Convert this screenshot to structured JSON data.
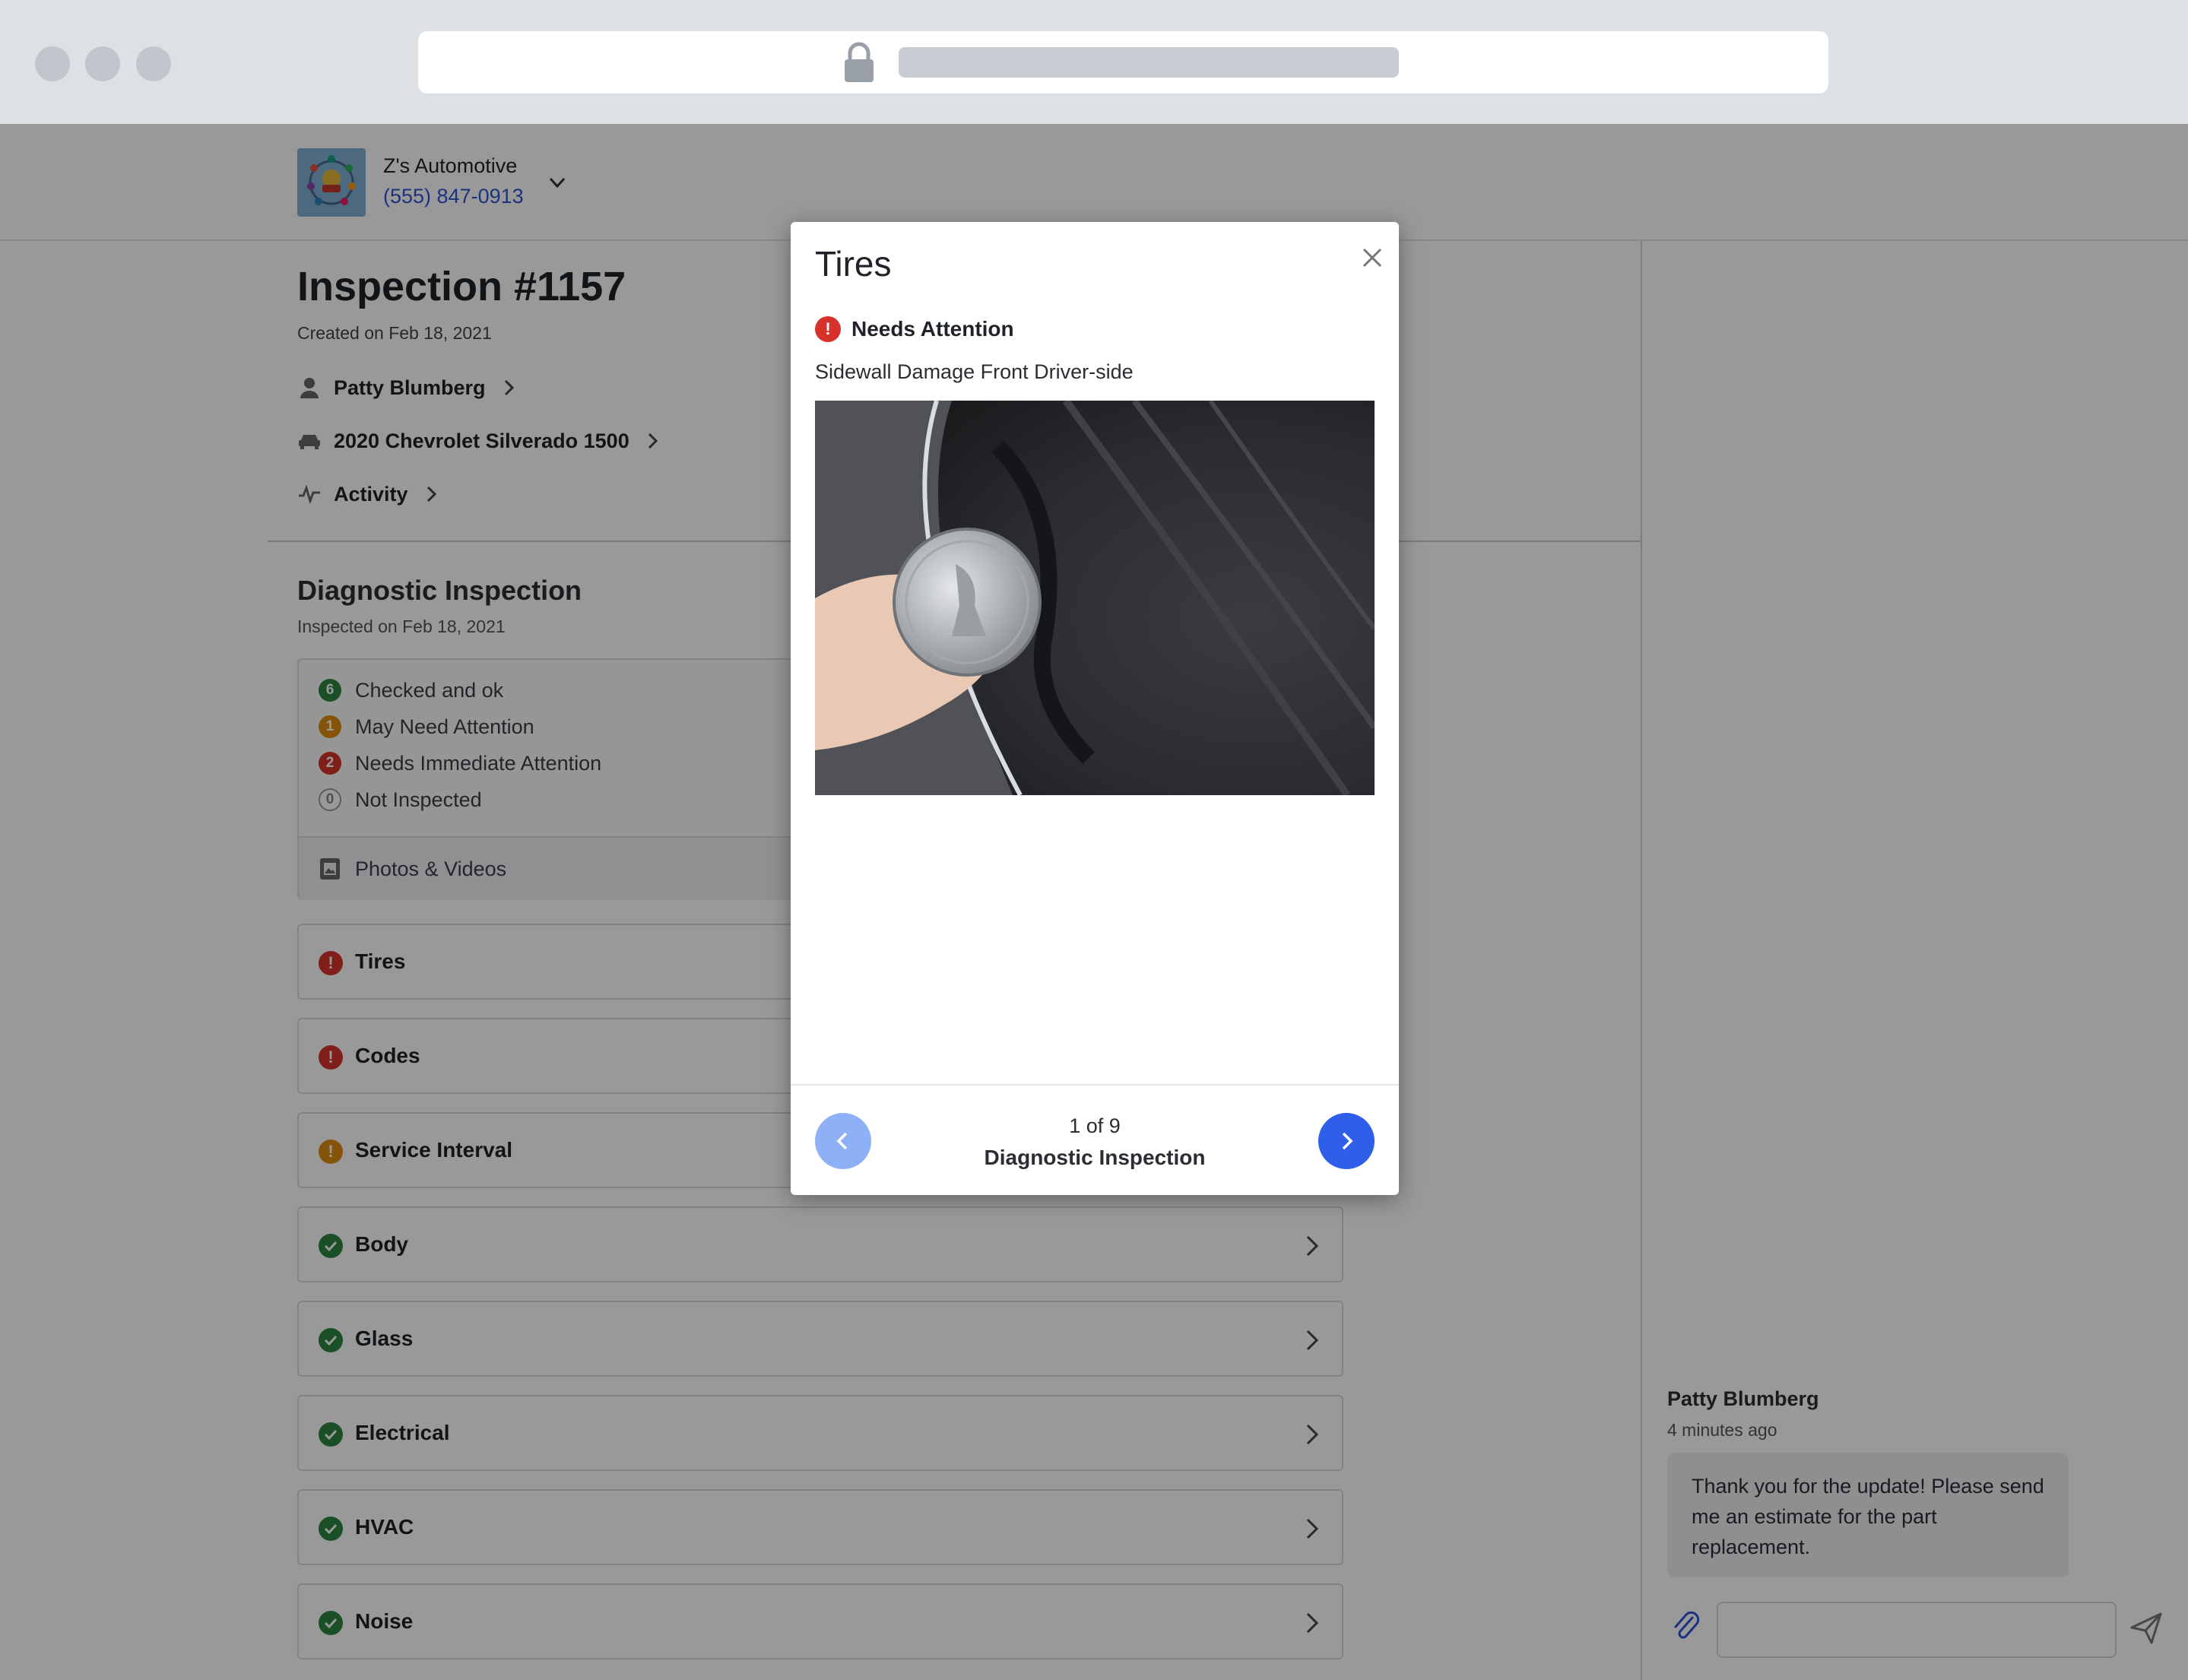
{
  "shop": {
    "name": "Z's Automotive",
    "phone": "(555) 847-0913"
  },
  "inspection": {
    "title": "Inspection #1157",
    "created": "Created on Feb 18, 2021",
    "customer": "Patty Blumberg",
    "vehicle": "2020 Chevrolet Silverado 1500",
    "activity": "Activity"
  },
  "section": {
    "title": "Diagnostic Inspection",
    "subtitle": "Inspected on Feb 18, 2021"
  },
  "summary": {
    "checked_count": "6",
    "checked_label": "Checked and ok",
    "may_count": "1",
    "may_label": "May Need Attention",
    "needs_count": "2",
    "needs_label": "Needs Immediate Attention",
    "not_count": "0",
    "not_label": "Not Inspected",
    "photos_label": "Photos & Videos"
  },
  "items": [
    {
      "label": "Tires",
      "status": "immediate"
    },
    {
      "label": "Codes",
      "status": "immediate"
    },
    {
      "label": "Service Interval",
      "status": "may"
    },
    {
      "label": "Body",
      "status": "ok"
    },
    {
      "label": "Glass",
      "status": "ok"
    },
    {
      "label": "Electrical",
      "status": "ok"
    },
    {
      "label": "HVAC",
      "status": "ok"
    },
    {
      "label": "Noise",
      "status": "ok"
    }
  ],
  "colors": {
    "ok": "#2e8540",
    "may": "#e08a12",
    "immediate": "#d6322b",
    "accent": "#2f5fe8",
    "link": "#2f54d6"
  },
  "chat": {
    "author": "Patty Blumberg",
    "time": "4 minutes ago",
    "message": "Thank you for the update! Please send me an estimate for the part replacement.",
    "input_placeholder": ""
  },
  "modal": {
    "title": "Tires",
    "status": "Needs Attention",
    "description": "Sidewall Damage Front Driver-side",
    "counter": "1 of 9",
    "section": "Diagnostic Inspection"
  }
}
